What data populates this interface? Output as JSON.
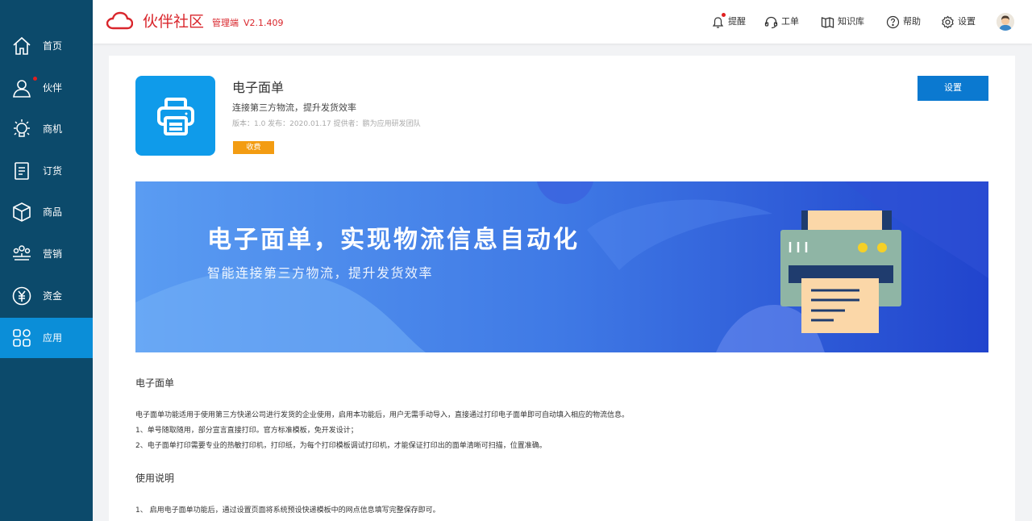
{
  "sidebar": {
    "items": [
      {
        "label": "首页",
        "icon": "home-icon"
      },
      {
        "label": "伙伴",
        "icon": "user-icon",
        "dot": true
      },
      {
        "label": "商机",
        "icon": "lightbulb-icon"
      },
      {
        "label": "订货",
        "icon": "order-icon"
      },
      {
        "label": "商品",
        "icon": "cube-icon"
      },
      {
        "label": "营销",
        "icon": "marketing-icon"
      },
      {
        "label": "资金",
        "icon": "yuan-icon"
      },
      {
        "label": "应用",
        "icon": "apps-icon",
        "active": true
      }
    ]
  },
  "header": {
    "brand": "伙伴社区",
    "brand_sub": "管理端",
    "version": "V2.1.409",
    "actions": [
      {
        "label": "提醒",
        "icon": "bell-icon"
      },
      {
        "label": "工单",
        "icon": "headset-icon"
      },
      {
        "label": "知识库",
        "icon": "book-icon"
      },
      {
        "label": "帮助",
        "icon": "help-icon"
      },
      {
        "label": "设置",
        "icon": "gear-icon"
      }
    ]
  },
  "app": {
    "title": "电子面单",
    "description": "连接第三方物流，提升发货效率",
    "meta": "版本：1.0  发布：2020.01.17  提供者：鹏为应用研发团队",
    "badge": "收费",
    "settings_label": "设置"
  },
  "banner": {
    "title": "电子面单，实现物流信息自动化",
    "subtitle": "智能连接第三方物流，提升发货效率"
  },
  "content": {
    "section1_title": "电子面单",
    "section1_lines": [
      "电子面单功能适用于使用第三方快递公司进行发货的企业使用，启用本功能后，用户无需手动导入，直接通过打印电子面单即可自动填入相应的物流信息。",
      "1、单号随取随用，部分宣言直接打印。官方标准模板，免开发设计；",
      "2、电子面单打印需要专业的热敏打印机，打印纸，为每个打印模板调试打印机，才能保证打印出的面单清晰可扫描，位置准确。"
    ],
    "section2_title": "使用说明",
    "section2_lines": [
      "1、 启用电子面单功能后，通过设置页面将系统预设快递模板中的网点信息填写完整保存即可。"
    ]
  },
  "colors": {
    "sidebar_bg": "#0c4a6b",
    "sidebar_active": "#0b8ed8",
    "brand_red": "#d9262c",
    "primary_blue": "#0b79d0",
    "badge_orange": "#f39c12"
  }
}
